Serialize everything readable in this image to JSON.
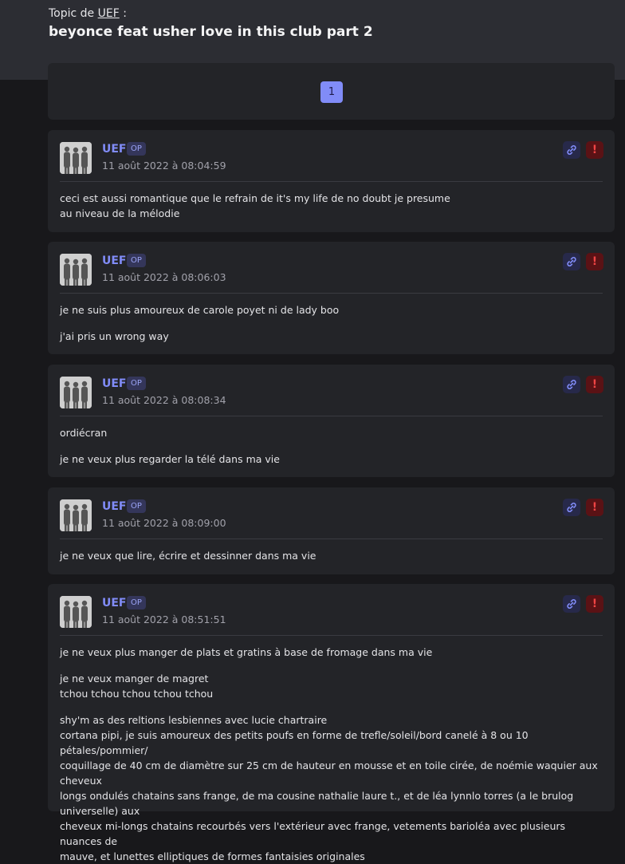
{
  "header": {
    "topic_prefix": "Topic de",
    "author": "UEF",
    "colon": " :",
    "title": "beyonce feat usher love in this club part 2"
  },
  "pagination": {
    "pages": [
      "1"
    ],
    "current": "1"
  },
  "posts": [
    {
      "username": "UEF",
      "badge": "OP",
      "timestamp": "11 août 2022 à 08:04:59",
      "paragraphs": [
        [
          "ceci est aussi romantique que le refrain de it's my life de no doubt je presume",
          "au niveau de la mélodie"
        ]
      ]
    },
    {
      "username": "UEF",
      "badge": "OP",
      "timestamp": "11 août 2022 à 08:06:03",
      "paragraphs": [
        [
          "je ne suis plus amoureux de carole poyet ni de lady boo"
        ],
        [
          "j'ai pris un wrong way"
        ]
      ]
    },
    {
      "username": "UEF",
      "badge": "OP",
      "timestamp": "11 août 2022 à 08:08:34",
      "paragraphs": [
        [
          "ordiécran"
        ],
        [
          "je ne veux plus regarder la télé dans ma vie"
        ]
      ]
    },
    {
      "username": "UEF",
      "badge": "OP",
      "timestamp": "11 août 2022 à 08:09:00",
      "paragraphs": [
        [
          "je ne veux que lire, écrire et dessinner dans ma vie"
        ]
      ]
    },
    {
      "username": "UEF",
      "badge": "OP",
      "timestamp": "11 août 2022 à 08:51:51",
      "paragraphs": [
        [
          "je ne veux plus manger de plats et gratins à base de fromage dans ma vie"
        ],
        [
          "je ne veux manger de magret",
          "tchou tchou tchou tchou tchou"
        ],
        [
          "shy'm as des reltions lesbiennes avec lucie chartraire",
          "cortana pipi, je suis amoureux des petits poufs en forme de trefle/soleil/bord canelé à 8 ou 10 pétales/pommier/",
          "coquillage de 40 cm de diamètre sur 25 cm de hauteur en mousse et en toile cirée, de noémie waquier aux cheveux",
          "longs ondulés chatains sans frange, de ma cousine nathalie laure t., et de léa lynnlo torres (a le brulog universelle) aux",
          "cheveux mi-longs chatains recourbés vers l'extérieur avec frange, vetements barioléa avec plusieurs nuances de",
          "mauve, et lunettes elliptiques de formes fantaisies originales"
        ]
      ]
    }
  ],
  "icons": {
    "link": "link-icon",
    "report": "exclamation-icon"
  },
  "colors": {
    "accent": "#818cf8",
    "report": "#ef4444",
    "background": "#18181b",
    "card": "#232428"
  }
}
